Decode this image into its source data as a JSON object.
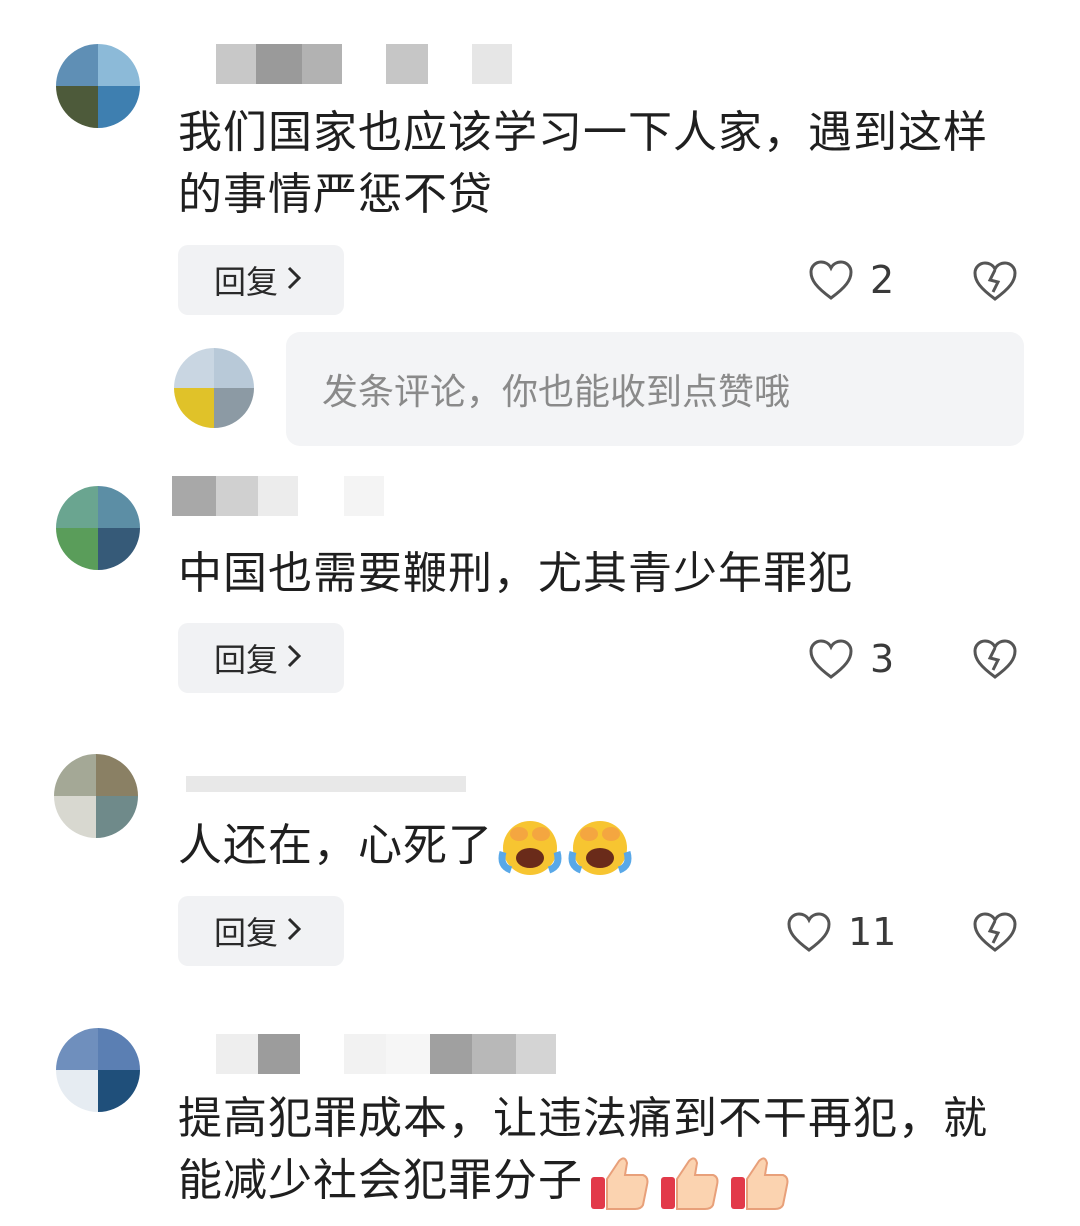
{
  "comments": [
    {
      "text": "我们国家也应该学习一下人家，遇到这样的事情严惩不贷",
      "reply_label": "回复",
      "likes": "2"
    },
    {
      "text": "中国也需要鞭刑，尤其青少年罪犯",
      "reply_label": "回复",
      "likes": "3"
    },
    {
      "text": "人还在，心死了",
      "emojis": [
        "laugh-cry-emoji",
        "laugh-cry-emoji"
      ],
      "reply_label": "回复",
      "likes": "11"
    },
    {
      "text": "提高犯罪成本，让违法痛到不干再犯，就能减少社会犯罪分子",
      "emojis": [
        "thumbs-up-emoji",
        "thumbs-up-emoji",
        "thumbs-up-emoji"
      ]
    }
  ],
  "comment_input": {
    "placeholder": "发条评论，你也能收到点赞哦"
  },
  "colors": {
    "button_bg": "#f1f2f4",
    "input_bg": "#f3f4f6",
    "placeholder": "#8a8a8a",
    "icon": "#555555"
  }
}
